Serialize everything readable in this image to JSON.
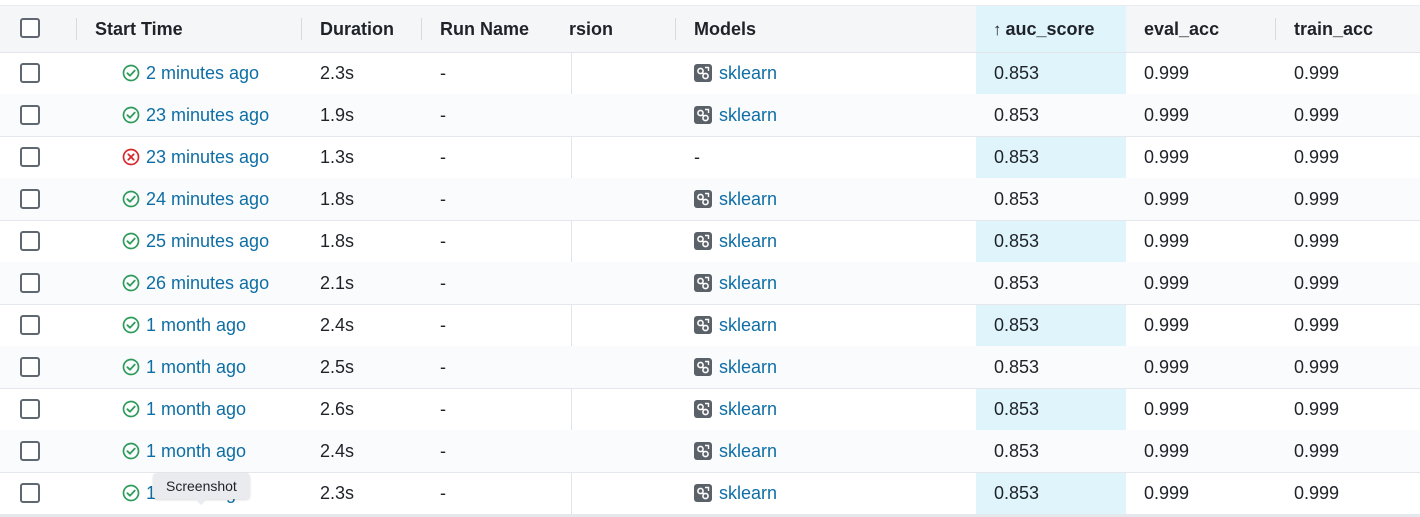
{
  "columns": {
    "start_time": "Start Time",
    "duration": "Duration",
    "run_name": "Run Name",
    "version": "rsion",
    "models": "Models",
    "auc_score": "auc_score",
    "eval_acc": "eval_acc",
    "train_acc": "train_acc",
    "sort_indicator": "↑"
  },
  "rows": [
    {
      "status": "success",
      "start": "2 minutes ago",
      "duration": "2.3s",
      "run_name": "-",
      "model": "sklearn",
      "auc": "0.853",
      "eval": "0.999",
      "train": "0.999"
    },
    {
      "status": "success",
      "start": "23 minutes ago",
      "duration": "1.9s",
      "run_name": "-",
      "model": "sklearn",
      "auc": "0.853",
      "eval": "0.999",
      "train": "0.999"
    },
    {
      "status": "failed",
      "start": "23 minutes ago",
      "duration": "1.3s",
      "run_name": "-",
      "model": "-",
      "auc": "0.853",
      "eval": "0.999",
      "train": "0.999"
    },
    {
      "status": "success",
      "start": "24 minutes ago",
      "duration": "1.8s",
      "run_name": "-",
      "model": "sklearn",
      "auc": "0.853",
      "eval": "0.999",
      "train": "0.999"
    },
    {
      "status": "success",
      "start": "25 minutes ago",
      "duration": "1.8s",
      "run_name": "-",
      "model": "sklearn",
      "auc": "0.853",
      "eval": "0.999",
      "train": "0.999"
    },
    {
      "status": "success",
      "start": "26 minutes ago",
      "duration": "2.1s",
      "run_name": "-",
      "model": "sklearn",
      "auc": "0.853",
      "eval": "0.999",
      "train": "0.999"
    },
    {
      "status": "success",
      "start": "1 month ago",
      "duration": "2.4s",
      "run_name": "-",
      "model": "sklearn",
      "auc": "0.853",
      "eval": "0.999",
      "train": "0.999"
    },
    {
      "status": "success",
      "start": "1 month ago",
      "duration": "2.5s",
      "run_name": "-",
      "model": "sklearn",
      "auc": "0.853",
      "eval": "0.999",
      "train": "0.999"
    },
    {
      "status": "success",
      "start": "1 month ago",
      "duration": "2.6s",
      "run_name": "-",
      "model": "sklearn",
      "auc": "0.853",
      "eval": "0.999",
      "train": "0.999"
    },
    {
      "status": "success",
      "start": "1 month ago",
      "duration": "2.4s",
      "run_name": "-",
      "model": "sklearn",
      "auc": "0.853",
      "eval": "0.999",
      "train": "0.999"
    },
    {
      "status": "success",
      "start": "1 month ago",
      "duration": "2.3s",
      "run_name": "-",
      "model": "sklearn",
      "auc": "0.853",
      "eval": "0.999",
      "train": "0.999"
    }
  ],
  "tooltip": "Screenshot",
  "colors": {
    "success": "#2e9b5b",
    "failed": "#d8282c",
    "link": "#0e6ea5",
    "sorted_column": "#dff4fb"
  },
  "icons": {
    "success": "check-circle-icon",
    "failed": "x-circle-icon",
    "model": "model-icon"
  }
}
